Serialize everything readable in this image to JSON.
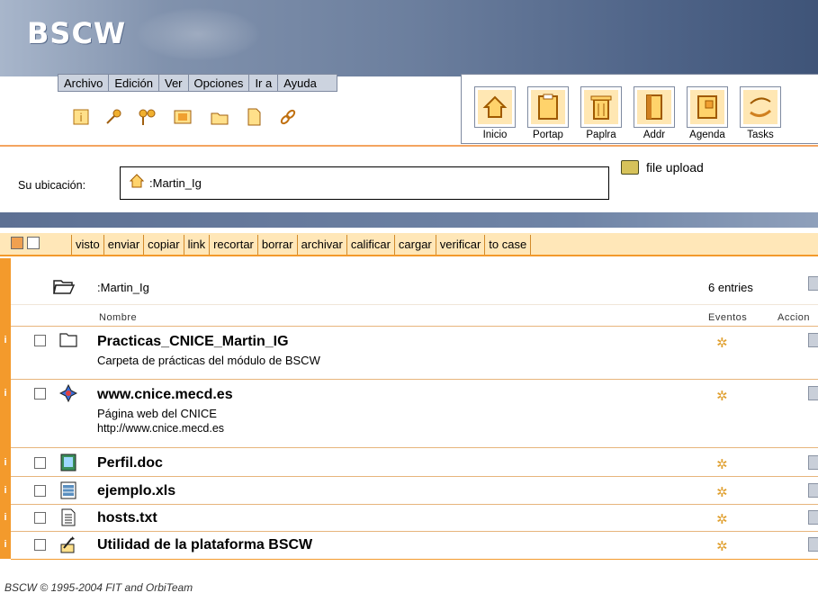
{
  "app": {
    "logo": "BSCW"
  },
  "menu": [
    "Archivo",
    "Edición",
    "Ver",
    "Opciones",
    "Ir a",
    "Ayuda"
  ],
  "toolbar_icons": [
    "info-icon",
    "key-icon",
    "keys-icon",
    "picture-icon",
    "folder-icon",
    "document-icon",
    "link-icon"
  ],
  "nav": [
    {
      "label": "Inicio",
      "icon": "home-icon"
    },
    {
      "label": "Portap",
      "icon": "clipboard-icon"
    },
    {
      "label": "Paplra",
      "icon": "trash-icon"
    },
    {
      "label": "Addr",
      "icon": "address-book-icon"
    },
    {
      "label": "Agenda",
      "icon": "calendar-icon"
    },
    {
      "label": "Tasks",
      "icon": "tasks-icon"
    }
  ],
  "location": {
    "label": "Su ubicación:",
    "path": ":Martin_Ig"
  },
  "upload": {
    "label": "file upload"
  },
  "actions": [
    "visto",
    "enviar",
    "copiar",
    "link",
    "recortar",
    "borrar",
    "archivar",
    "calificar",
    "cargar",
    "verificar",
    "to case"
  ],
  "folder": {
    "name": ":Martin_Ig",
    "entries": "6 entries"
  },
  "columns": {
    "name": "Nombre",
    "events": "Eventos",
    "actions": "Accion"
  },
  "rows": [
    {
      "title": "Practicas_CNICE_Martin_IG",
      "desc1": "Carpeta de prácticas del módulo de BSCW",
      "desc2": "",
      "icon": "folder-icon"
    },
    {
      "title": "www.cnice.mecd.es",
      "desc1": "Página web del CNICE",
      "desc2": "http://www.cnice.mecd.es",
      "icon": "url-icon"
    },
    {
      "title": "Perfil.doc",
      "desc1": "",
      "desc2": "",
      "icon": "word-document-icon"
    },
    {
      "title": "ejemplo.xls",
      "desc1": "",
      "desc2": "",
      "icon": "spreadsheet-icon"
    },
    {
      "title": "hosts.txt",
      "desc1": "",
      "desc2": "",
      "icon": "text-file-icon"
    },
    {
      "title": "Utilidad de la plataforma BSCW",
      "desc1": "",
      "desc2": "",
      "icon": "note-icon"
    }
  ],
  "footer": {
    "text": "BSCW © 1995-2004 FIT and OrbiTeam"
  },
  "colors": {
    "orange": "#f39a2c",
    "header_blue": "#4f6488",
    "action_bg": "#ffe7b8"
  }
}
